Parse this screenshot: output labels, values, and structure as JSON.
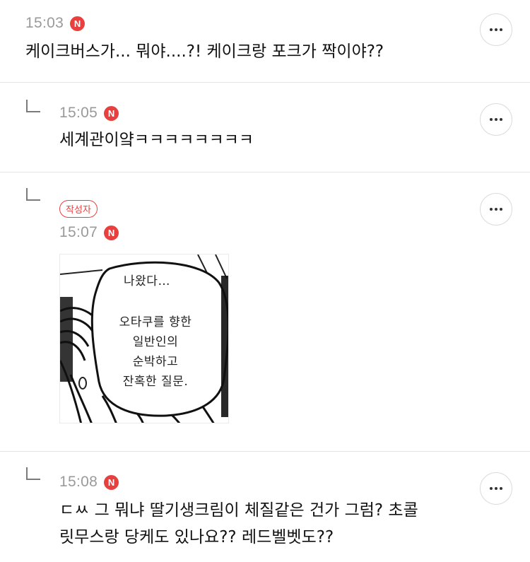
{
  "comments": [
    {
      "time": "15:03",
      "badge": "N",
      "text": "케이크버스가... 뭐야....?! 케이크랑 포크가 짝이야??"
    },
    {
      "time": "15:05",
      "badge": "N",
      "text": "세계관이얔ㅋㅋㅋㅋㅋㅋㅋㅋ"
    },
    {
      "author_label": "작성자",
      "time": "15:07",
      "badge": "N",
      "image": {
        "line1": "나왔다…",
        "line2": "오타쿠를 향한",
        "line3": "일반인의",
        "line4": "순박하고",
        "line5": "잔혹한 질문."
      }
    },
    {
      "time": "15:08",
      "badge": "N",
      "text_line1": "ㄷㅆ 그 뭐냐 딸기생크림이 체질같은 건가 그럼? 초콜",
      "text_line2": "릿무스랑 당케도 있나요?? 레드벨벳도??"
    }
  ],
  "icons": {
    "more": "more-horizontal-icon",
    "reply": "reply-arrow-icon",
    "new": "new-badge-icon"
  },
  "colors": {
    "accent": "#e8403f",
    "timestamp": "#9a9a9a",
    "divider": "#e4e4e4"
  }
}
